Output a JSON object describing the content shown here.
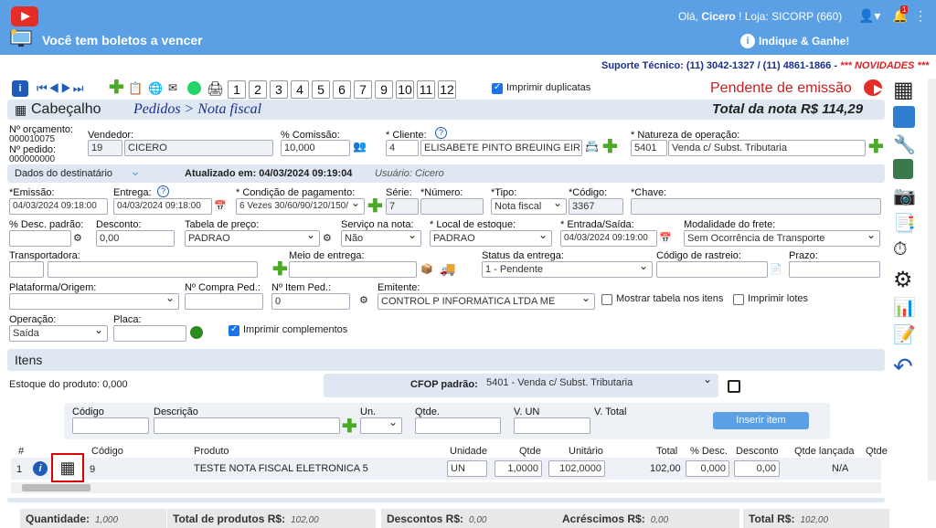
{
  "topbar": {
    "greeting_prefix": "Olá,",
    "user": "Cicero",
    "greeting_suffix": "!",
    "loja": "Loja: SICORP (660)",
    "alert": "Você tem boletos a vencer",
    "indique": "Indique & Ganhe!",
    "notif_count": "1"
  },
  "support": {
    "text": "Suporte Técnico: (11) 3042-1327 / (11) 4861-1866 -",
    "novidades": "*** NOVIDADES ***"
  },
  "toolbar": {
    "numbers": [
      "1",
      "2",
      "3",
      "4",
      "5",
      "6",
      "7",
      "9",
      "10",
      "11",
      "12"
    ],
    "print_dup_label": "Imprimir duplicatas",
    "status": "Pendente de emissão"
  },
  "header": {
    "section": "Cabeçalho",
    "breadcrumb": "Pedidos > Nota fiscal",
    "total": "Total da nota R$ 114,29"
  },
  "ident": {
    "orc_label": "Nº orçamento:",
    "orc_value": "000010075",
    "ped_label": "Nº pedido:",
    "ped_value": "000000000"
  },
  "fields": {
    "vendedor_label": "Vendedor:",
    "vendedor_code": "19",
    "vendedor_name": "CICERO",
    "comissao_label": "% Comissão:",
    "comissao": "10,000",
    "cliente_label": "* Cliente:",
    "cliente_code": "4",
    "cliente_name": "ELISABETE PINTO BREUING EIREL",
    "natureza_label": "* Natureza de operação:",
    "natureza_code": "5401",
    "natureza_name": "Venda c/ Subst. Tributaria",
    "dest_label": "Dados do destinatário",
    "atualizado": "Atualizado em: 04/03/2024 09:19:04",
    "usuario": "Usuário: Cicero",
    "emissao_label": "*Emissão:",
    "emissao": "04/03/2024 09:18:00",
    "entrega_label": "Entrega:",
    "entrega": "04/03/2024 09:18:00",
    "cond_label": "* Condição de pagamento:",
    "cond": "6 Vezes 30/60/90/120/150/",
    "serie_label": "Série:",
    "serie": "7",
    "numero_label": "*Número:",
    "numero": "",
    "tipo_label": "*Tipo:",
    "tipo": "Nota fiscal",
    "codigo_label": "*Código:",
    "codigo": "3367",
    "chave_label": "*Chave:",
    "chave": "",
    "desc_padrao_label": "% Desc. padrão:",
    "desc_padrao": "",
    "desconto_label": "Desconto:",
    "desconto": "0,00",
    "tabela_label": "Tabela de preço:",
    "tabela": "PADRAO",
    "servico_label": "Serviço na nota:",
    "servico": "Não",
    "local_label": "* Local de estoque:",
    "local": "PADRAO",
    "entrada_label": "* Entrada/Saída:",
    "entrada": "04/03/2024 09:19:00",
    "frete_label": "Modalidade do frete:",
    "frete": "Sem Ocorrência de Transporte",
    "transp_label": "Transportadora:",
    "transp": "",
    "meio_label": "Meio de entrega:",
    "meio": "",
    "status_ent_label": "Status da entrega:",
    "status_ent": "1 - Pendente",
    "rastreio_label": "Código de rastreio:",
    "rastreio": "",
    "prazo_label": "Prazo:",
    "prazo": "",
    "plataforma_label": "Plataforma/Origem:",
    "plataforma": "",
    "compra_label": "Nº Compra Ped.:",
    "compra": "",
    "item_ped_label": "Nº Item Ped.:",
    "item_ped": "0",
    "emitente_label": "Emitente:",
    "emitente": "CONTROL P INFORMATICA LTDA ME",
    "mostrar_tab_label": "Mostrar tabela nos itens",
    "imprimir_lotes_label": "Imprimir lotes",
    "operacao_label": "Operação:",
    "operacao": "Saída",
    "placa_label": "Placa:",
    "placa": "",
    "imp_comp_label": "Imprimir complementos"
  },
  "itens": {
    "title": "Itens",
    "estoque": "Estoque do produto: 0,000",
    "cfop_label": "CFOP padrão:",
    "cfop": "5401 - Venda c/ Subst. Tributaria",
    "add": {
      "codigo": "Código",
      "descricao": "Descrição",
      "un": "Un.",
      "qtde": "Qtde.",
      "vun": "V. UN",
      "vtotal": "V. Total",
      "insert_btn": "Inserir item"
    },
    "columns": [
      "#",
      "",
      "Código",
      "Produto",
      "Unidade",
      "Qtde",
      "Unitário",
      "Total",
      "% Desc.",
      "Desconto",
      "Qtde lançada",
      "Qtde"
    ],
    "rows": [
      {
        "n": "1",
        "codigo": "9",
        "produto": "TESTE NOTA FISCAL ELETRONICA 5",
        "unidade": "UN",
        "qtde": "1,0000",
        "unit": "102,0000",
        "total": "102,00",
        "pdesc": "0,000",
        "desc": "0,00",
        "lancada": "N/A"
      }
    ]
  },
  "totals": {
    "qtd_label": "Quantidade:",
    "qtd": "1,000",
    "prod_label": "Total de produtos R$:",
    "prod": "102,00",
    "desc_label": "Descontos R$:",
    "desc": "0,00",
    "acres_label": "Acréscimos R$:",
    "acres": "0,00",
    "total_label": "Total R$:",
    "total": "102,00"
  },
  "colors": {
    "topbar": "#5b9fe4",
    "accent_red": "#d22222",
    "navy": "#1a2f8a",
    "green": "#4caa28"
  }
}
